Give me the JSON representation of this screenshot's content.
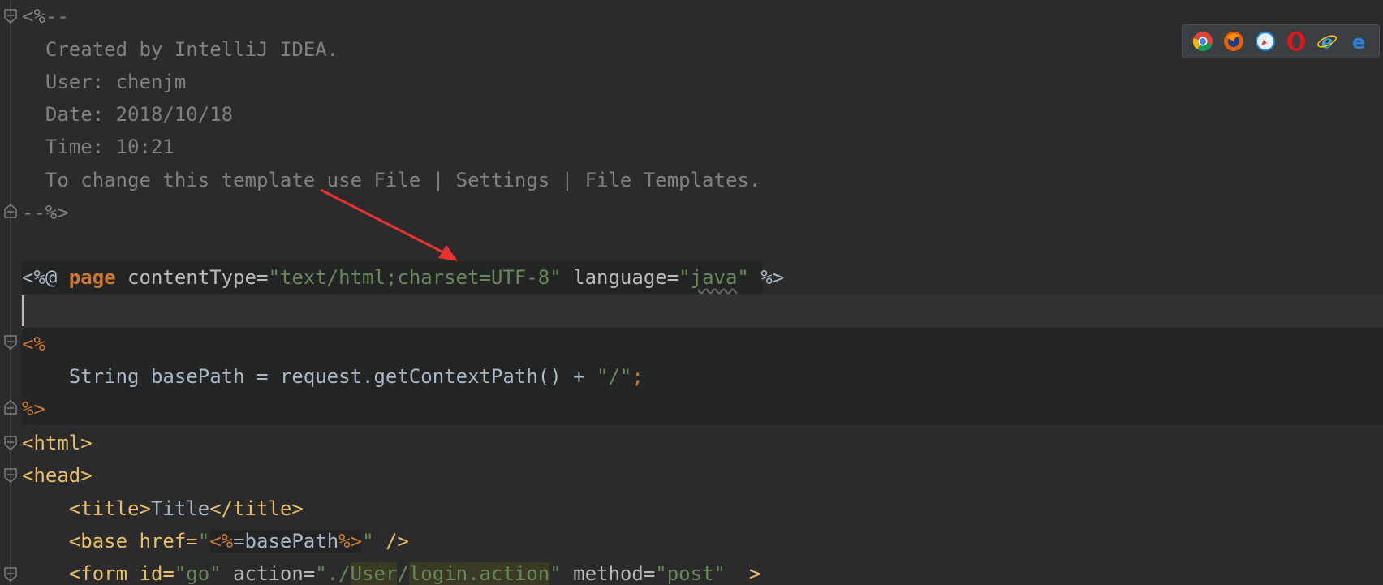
{
  "editor": {
    "comment_block": {
      "open": "<%--",
      "lines": [
        "  Created by IntelliJ IDEA.",
        "  User: chenjm",
        "  Date: 2018/10/18",
        "  Time: 10:21",
        "  To change this template use File | Settings | File Templates."
      ],
      "close": "--%>"
    },
    "directive": {
      "open": "<%@ ",
      "keyword": "page",
      "attr1_name": " contentType=",
      "attr1_value": "\"text/html;charset=UTF-8\"",
      "attr2_name": " language=",
      "attr2_value_q1": "\"",
      "attr2_value": "java",
      "attr2_value_q2": "\"",
      "close": " %>"
    },
    "scriptlet": {
      "open": "<%",
      "code": "    String basePath = request.getContextPath() + ",
      "string": "\"/\"",
      "semicolon": ";",
      "close": "%>"
    },
    "html_lines": {
      "html_open": "<html>",
      "head_open": "<head>",
      "title_open": "    <title>",
      "title_text": "Title",
      "title_close": "</title>",
      "base_open": "    <base href=",
      "base_q1": "\"",
      "base_jsp_open": "<%",
      "base_jsp_eq": "=basePath",
      "base_jsp_close": "%>",
      "base_q2": "\"",
      "base_close": " />",
      "form_open": "    <form id=",
      "form_id": "\"go\"",
      "form_action_name": " action=",
      "form_action_q1": "\"./",
      "form_action_user": "User",
      "form_action_slash": "/",
      "form_action_login": "login.action",
      "form_action_q2": "\"",
      "form_method_name": " method=",
      "form_method_value": "\"post\"",
      "form_close": "  >"
    }
  },
  "browser_bar": {
    "icons": [
      "chrome-icon",
      "firefox-icon",
      "safari-icon",
      "opera-icon",
      "ie-icon",
      "edge-icon"
    ]
  },
  "colors": {
    "background": "#2b2b2b",
    "comment": "#808080",
    "tag": "#e8bf6a",
    "keyword": "#cc7832",
    "string": "#6a8759",
    "text": "#a9b7c6",
    "annotation_arrow": "#e8322f"
  }
}
